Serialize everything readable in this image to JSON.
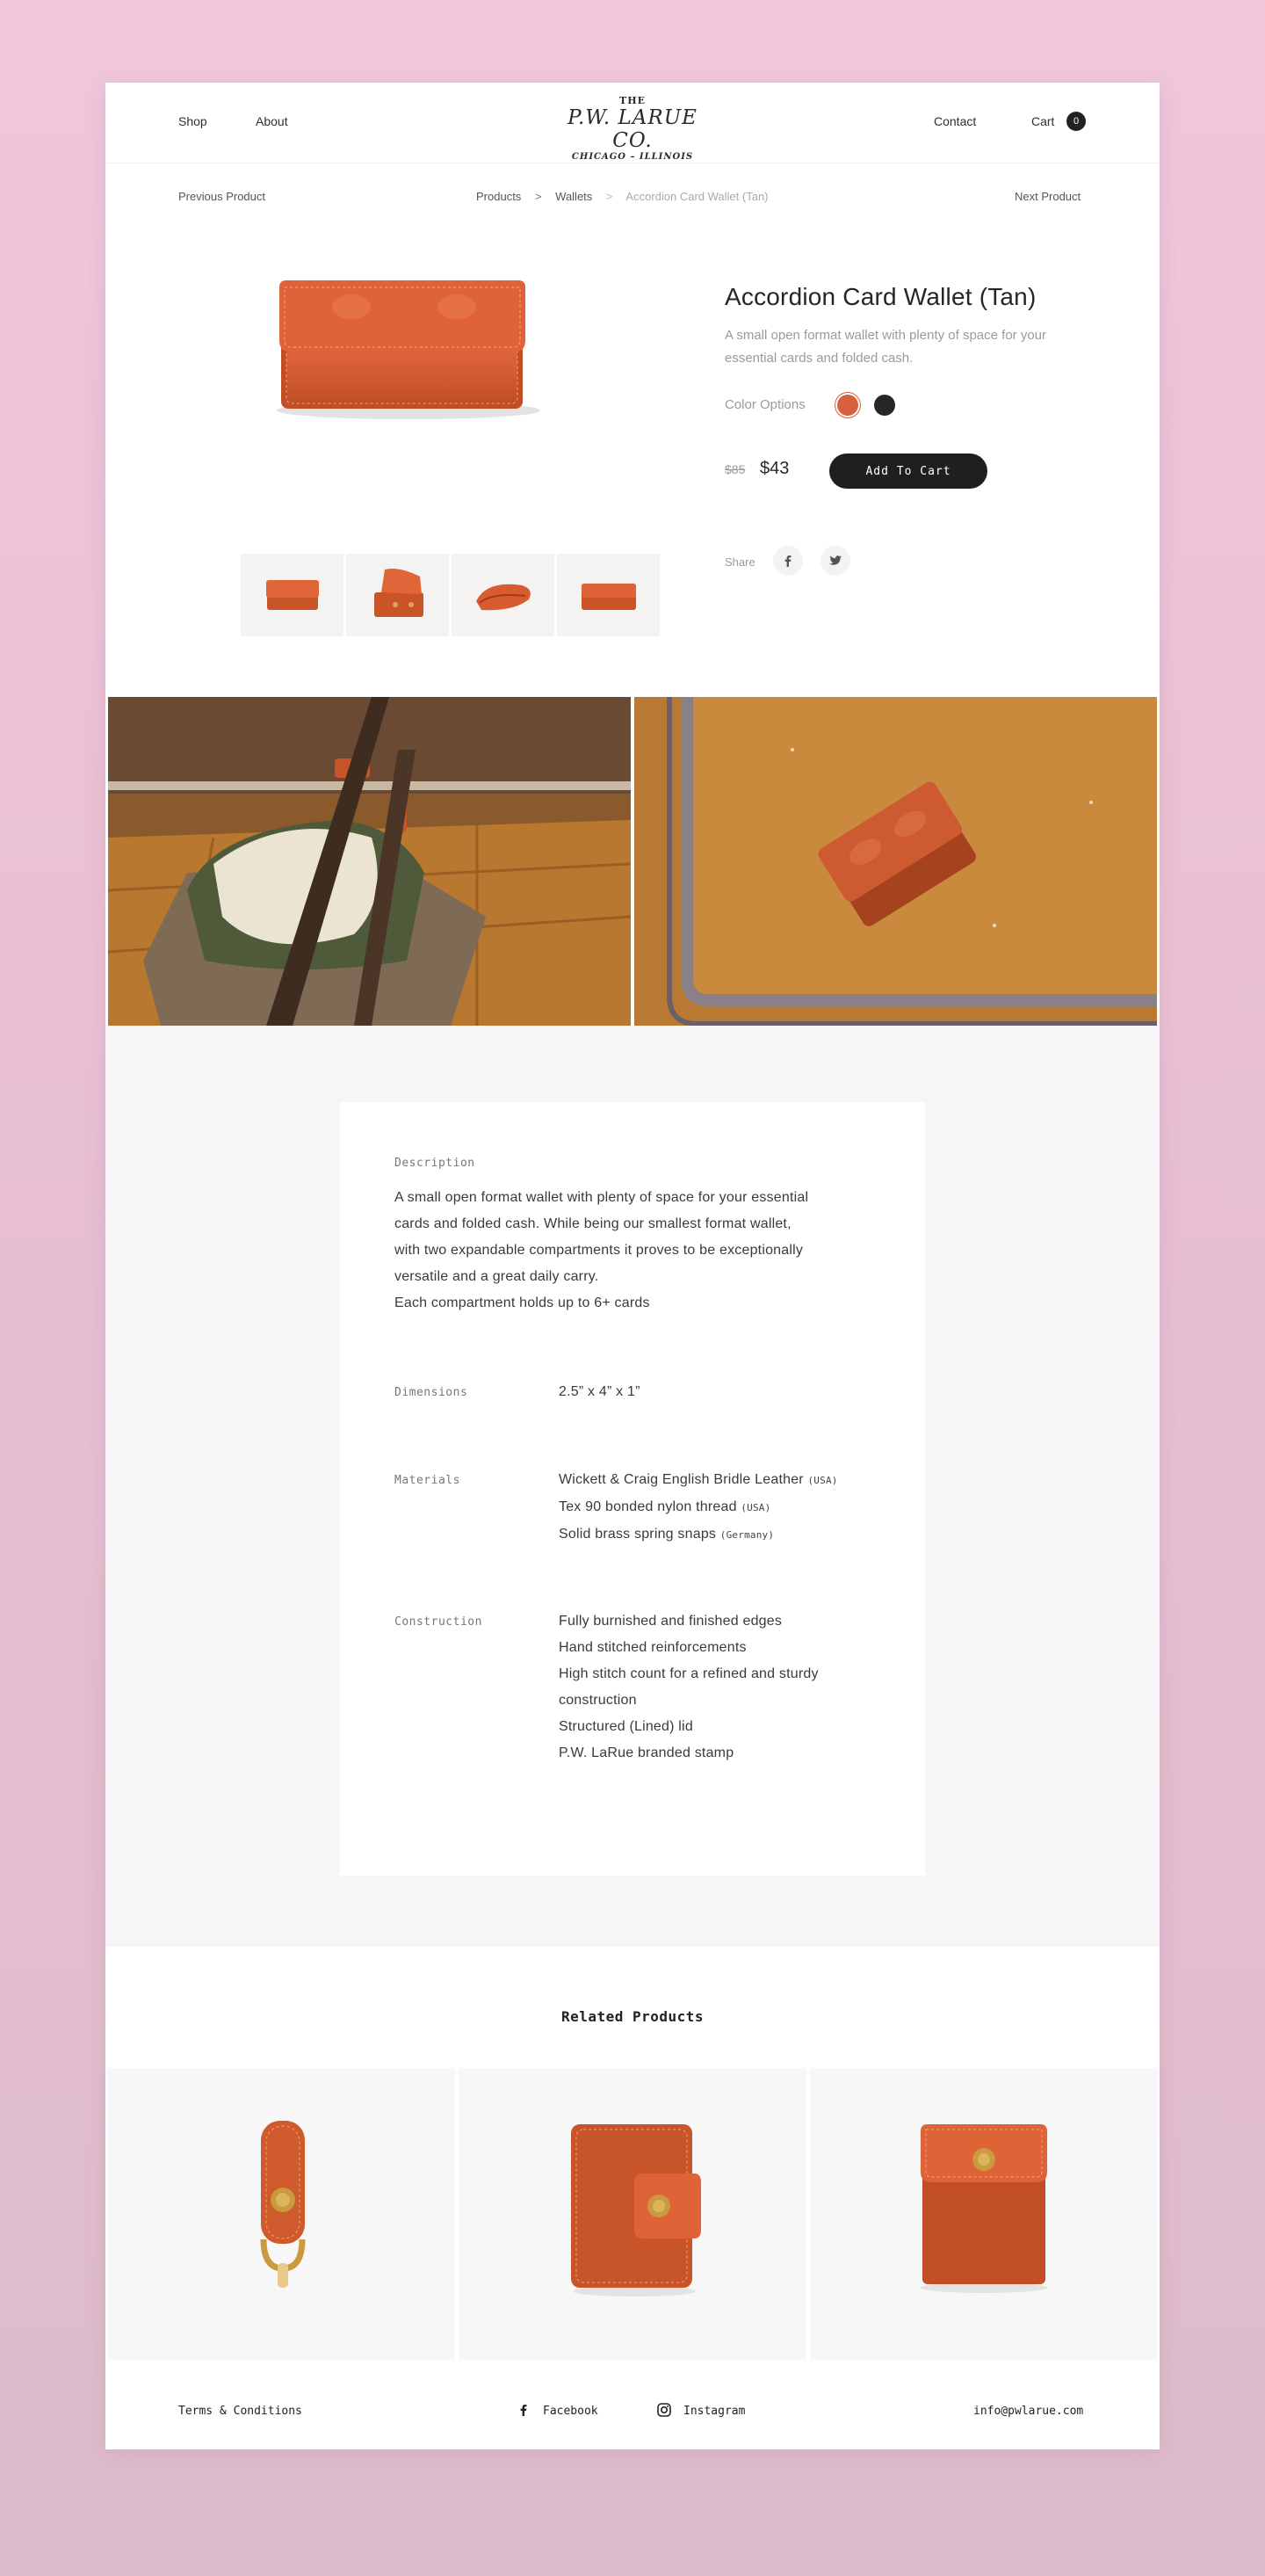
{
  "header": {
    "nav_left": [
      "Shop",
      "About"
    ],
    "logo": {
      "top": "THE",
      "name": "P.W. LARUE CO.",
      "city": "CHICAGO – ILLINOIS"
    },
    "contact_label": "Contact",
    "cart_label": "Cart",
    "cart_count": "0"
  },
  "breadcrumb": {
    "previous": "Previous Product",
    "items": [
      "Products",
      "Wallets",
      "Accordion Card Wallet (Tan)"
    ],
    "separator": ">",
    "next": "Next Product"
  },
  "product": {
    "title": "Accordion Card Wallet (Tan)",
    "short_description": "A small open format wallet with plenty of space for your essential cards and folded cash.",
    "color_options_label": "Color Options",
    "colors": [
      {
        "name": "Tan",
        "hex": "#d7603e",
        "selected": true
      },
      {
        "name": "Black",
        "hex": "#262626",
        "selected": false
      }
    ],
    "old_price": "$85",
    "price": "$43",
    "add_to_cart_label": "Add To Cart",
    "share_label": "Share",
    "share_icons": [
      "facebook-icon",
      "twitter-icon"
    ],
    "thumbnails": [
      "wallet-closed",
      "wallet-open",
      "wallet-side",
      "wallet-flat"
    ]
  },
  "details": {
    "description_label": "Description",
    "description_lines": [
      "A small open format wallet with plenty of space for your essential",
      "cards and folded cash. While being our smallest format wallet,",
      "with two expandable compartments it proves to be exceptionally",
      "versatile and a great daily carry."
    ],
    "capacity_note": "Each compartment holds up to 6+ cards",
    "dimensions_label": "Dimensions",
    "dimensions_value": "2.5” x 4” x 1”",
    "materials_label": "Materials",
    "materials": [
      {
        "text": "Wickett & Craig English Bridle Leather",
        "origin": "(USA)"
      },
      {
        "text": "Tex 90 bonded nylon thread",
        "origin": "(USA)"
      },
      {
        "text": "Solid brass spring snaps",
        "origin": "(Germany)"
      }
    ],
    "construction_label": "Construction",
    "construction": [
      "Fully burnished and finished edges",
      "Hand stitched reinforcements",
      "High stitch count for a refined and sturdy",
      "construction",
      "Structured (Lined) lid",
      "P.W. LaRue branded stamp"
    ]
  },
  "related": {
    "title": "Related Products",
    "items": [
      "key-fob",
      "card-wallet-snap",
      "card-case-snap"
    ]
  },
  "footer": {
    "terms": "Terms & Conditions",
    "facebook": "Facebook",
    "instagram": "Instagram",
    "email": "info@pwlarue.com"
  },
  "colors": {
    "accent_tan": "#d7603e",
    "dark": "#1f1f1f",
    "muted_text": "#9a9a9a",
    "background_pink": "#f1c6da"
  }
}
